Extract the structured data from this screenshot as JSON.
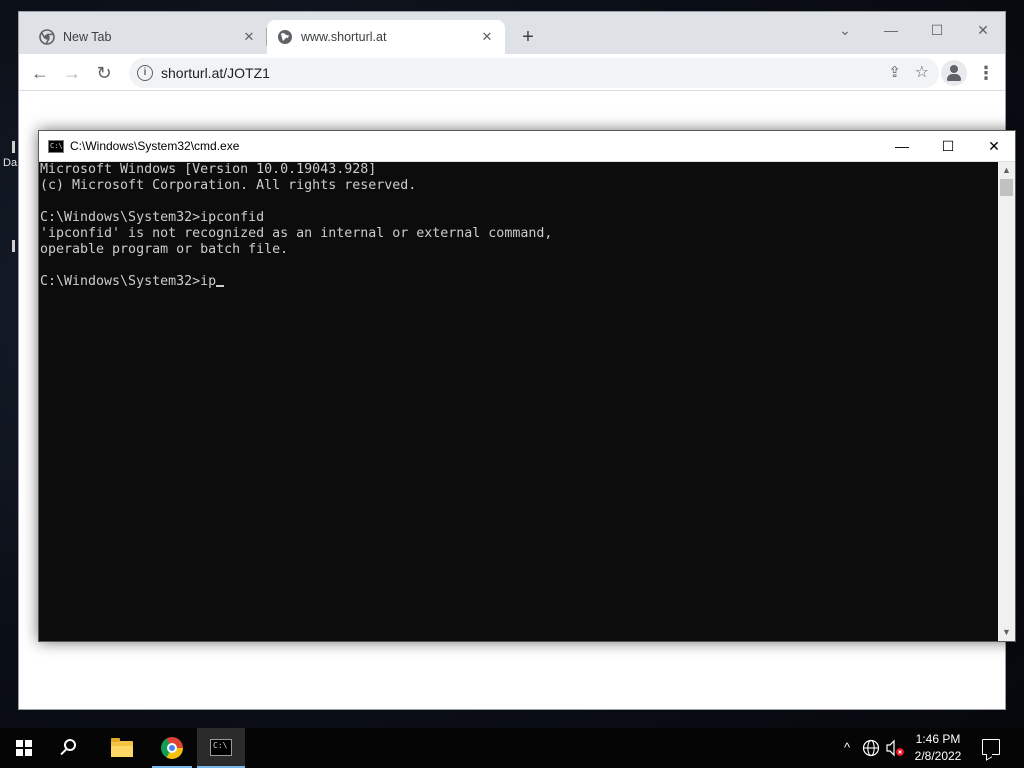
{
  "desktop": {
    "fragments": [
      "Da"
    ]
  },
  "browser": {
    "tabs": [
      {
        "title": "New Tab",
        "icon": "chrome-icon",
        "active": false
      },
      {
        "title": "www.shorturl.at",
        "icon": "globe-icon",
        "active": true
      }
    ],
    "new_tab_symbol": "+",
    "url": "shorturl.at/JOTZ1",
    "window_controls": {
      "minimize": "—",
      "maximize": "☐",
      "close": "✕",
      "tab_search": "⌄"
    },
    "nav": {
      "back": "←",
      "forward": "→",
      "reload": "↻"
    },
    "omnibox_icons": {
      "info": "i",
      "share": "⇪",
      "bookmark": "☆"
    },
    "menu": "⋮"
  },
  "cmd": {
    "title": "C:\\Windows\\System32\\cmd.exe",
    "icon_text": "C:\\",
    "controls": {
      "minimize": "—",
      "maximize": "☐",
      "close": "✕"
    },
    "lines": [
      "Microsoft Windows [Version 10.0.19043.928]",
      "(c) Microsoft Corporation. All rights reserved.",
      "",
      "C:\\Windows\\System32>ipconfid",
      "'ipconfid' is not recognized as an internal or external command,",
      "operable program or batch file.",
      ""
    ],
    "prompt": "C:\\Windows\\System32>",
    "current_input": "ip"
  },
  "taskbar": {
    "items": [
      {
        "name": "start-button",
        "icon": "windows-logo-icon"
      },
      {
        "name": "search-button",
        "icon": "search-icon"
      },
      {
        "name": "file-explorer",
        "icon": "folder-icon"
      },
      {
        "name": "chrome",
        "icon": "chrome-icon"
      },
      {
        "name": "command-prompt",
        "icon": "cmd-icon",
        "active": true
      }
    ],
    "tray": {
      "chevron": "^",
      "network_icon": "globe-network-icon",
      "volume_icon": "volume-muted-icon",
      "time": "1:46 PM",
      "date": "2/8/2022"
    }
  }
}
